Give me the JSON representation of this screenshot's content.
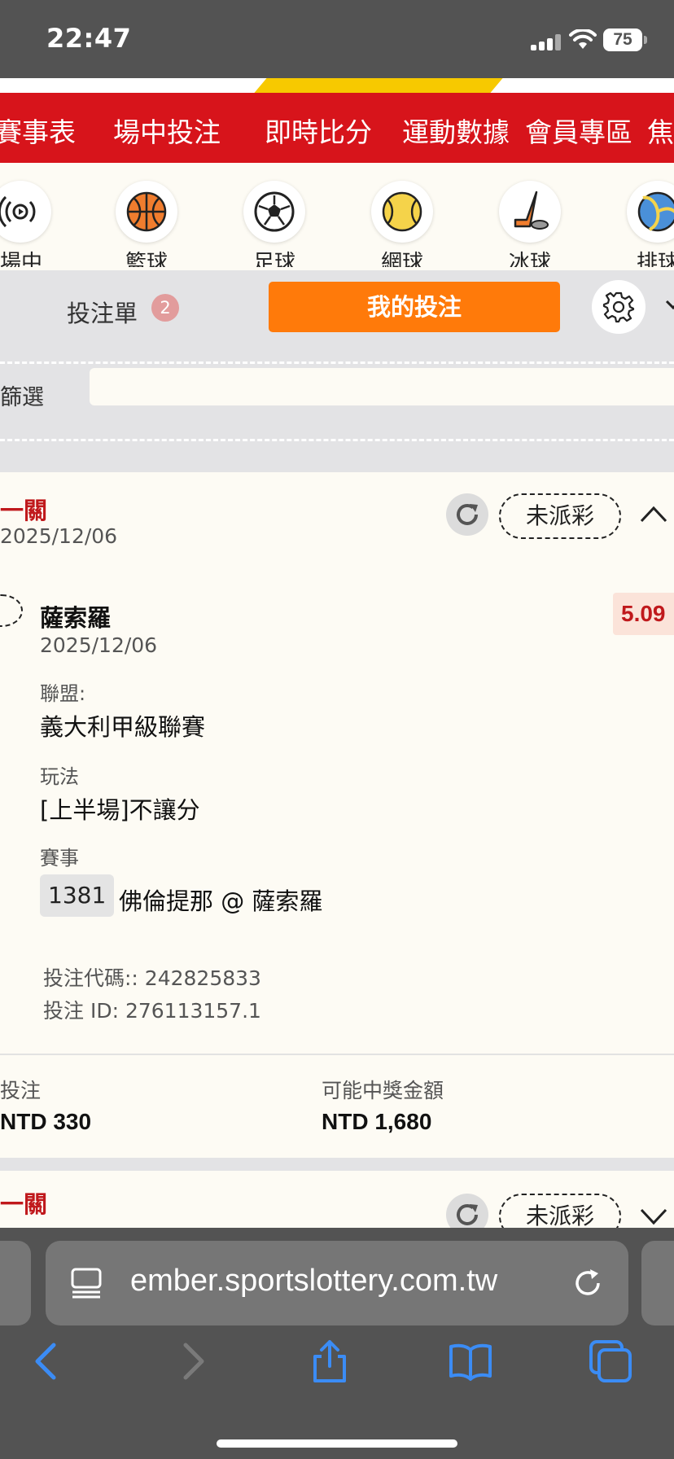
{
  "status_bar": {
    "time": "22:47",
    "battery": "75"
  },
  "nav": {
    "items": [
      "賽事表",
      "場中投注",
      "即時比分",
      "運動數據",
      "會員專區",
      "焦"
    ]
  },
  "sports": [
    "場中",
    "籃球",
    "足球",
    "網球",
    "冰球",
    "排球"
  ],
  "tabs": {
    "bet_slip": "投注單",
    "bet_slip_count": "2",
    "my_bets": "我的投注"
  },
  "filter": {
    "label": "篩選"
  },
  "bet": {
    "type": "一關",
    "date": "2025/12/06",
    "status": "未派彩",
    "selection": "薩索羅",
    "odds": "5.09",
    "event_date": "2025/12/06",
    "league_label": "聯盟:",
    "league": "義大利甲級聯賽",
    "market_label": "玩法",
    "market": "[上半場]不讓分",
    "event_label": "賽事",
    "event_code": "1381",
    "event": "佛倫提那 @ 薩索羅",
    "bet_code": "投注代碼:: 242825833",
    "bet_id": "投注 ID: 276113157.1",
    "stake_label": "投注",
    "stake": "NTD 330",
    "payout_label": "可能中獎金額",
    "payout": "NTD 1,680"
  },
  "bet2": {
    "type": "一關",
    "status": "未派彩"
  },
  "browser": {
    "url": "ember.sportslottery.com.tw"
  },
  "colors": {
    "nav_red": "#d7141b",
    "accent_orange": "#ff7a0a",
    "odds_red": "#c0191c",
    "ios_blue": "#3b8cf5"
  }
}
